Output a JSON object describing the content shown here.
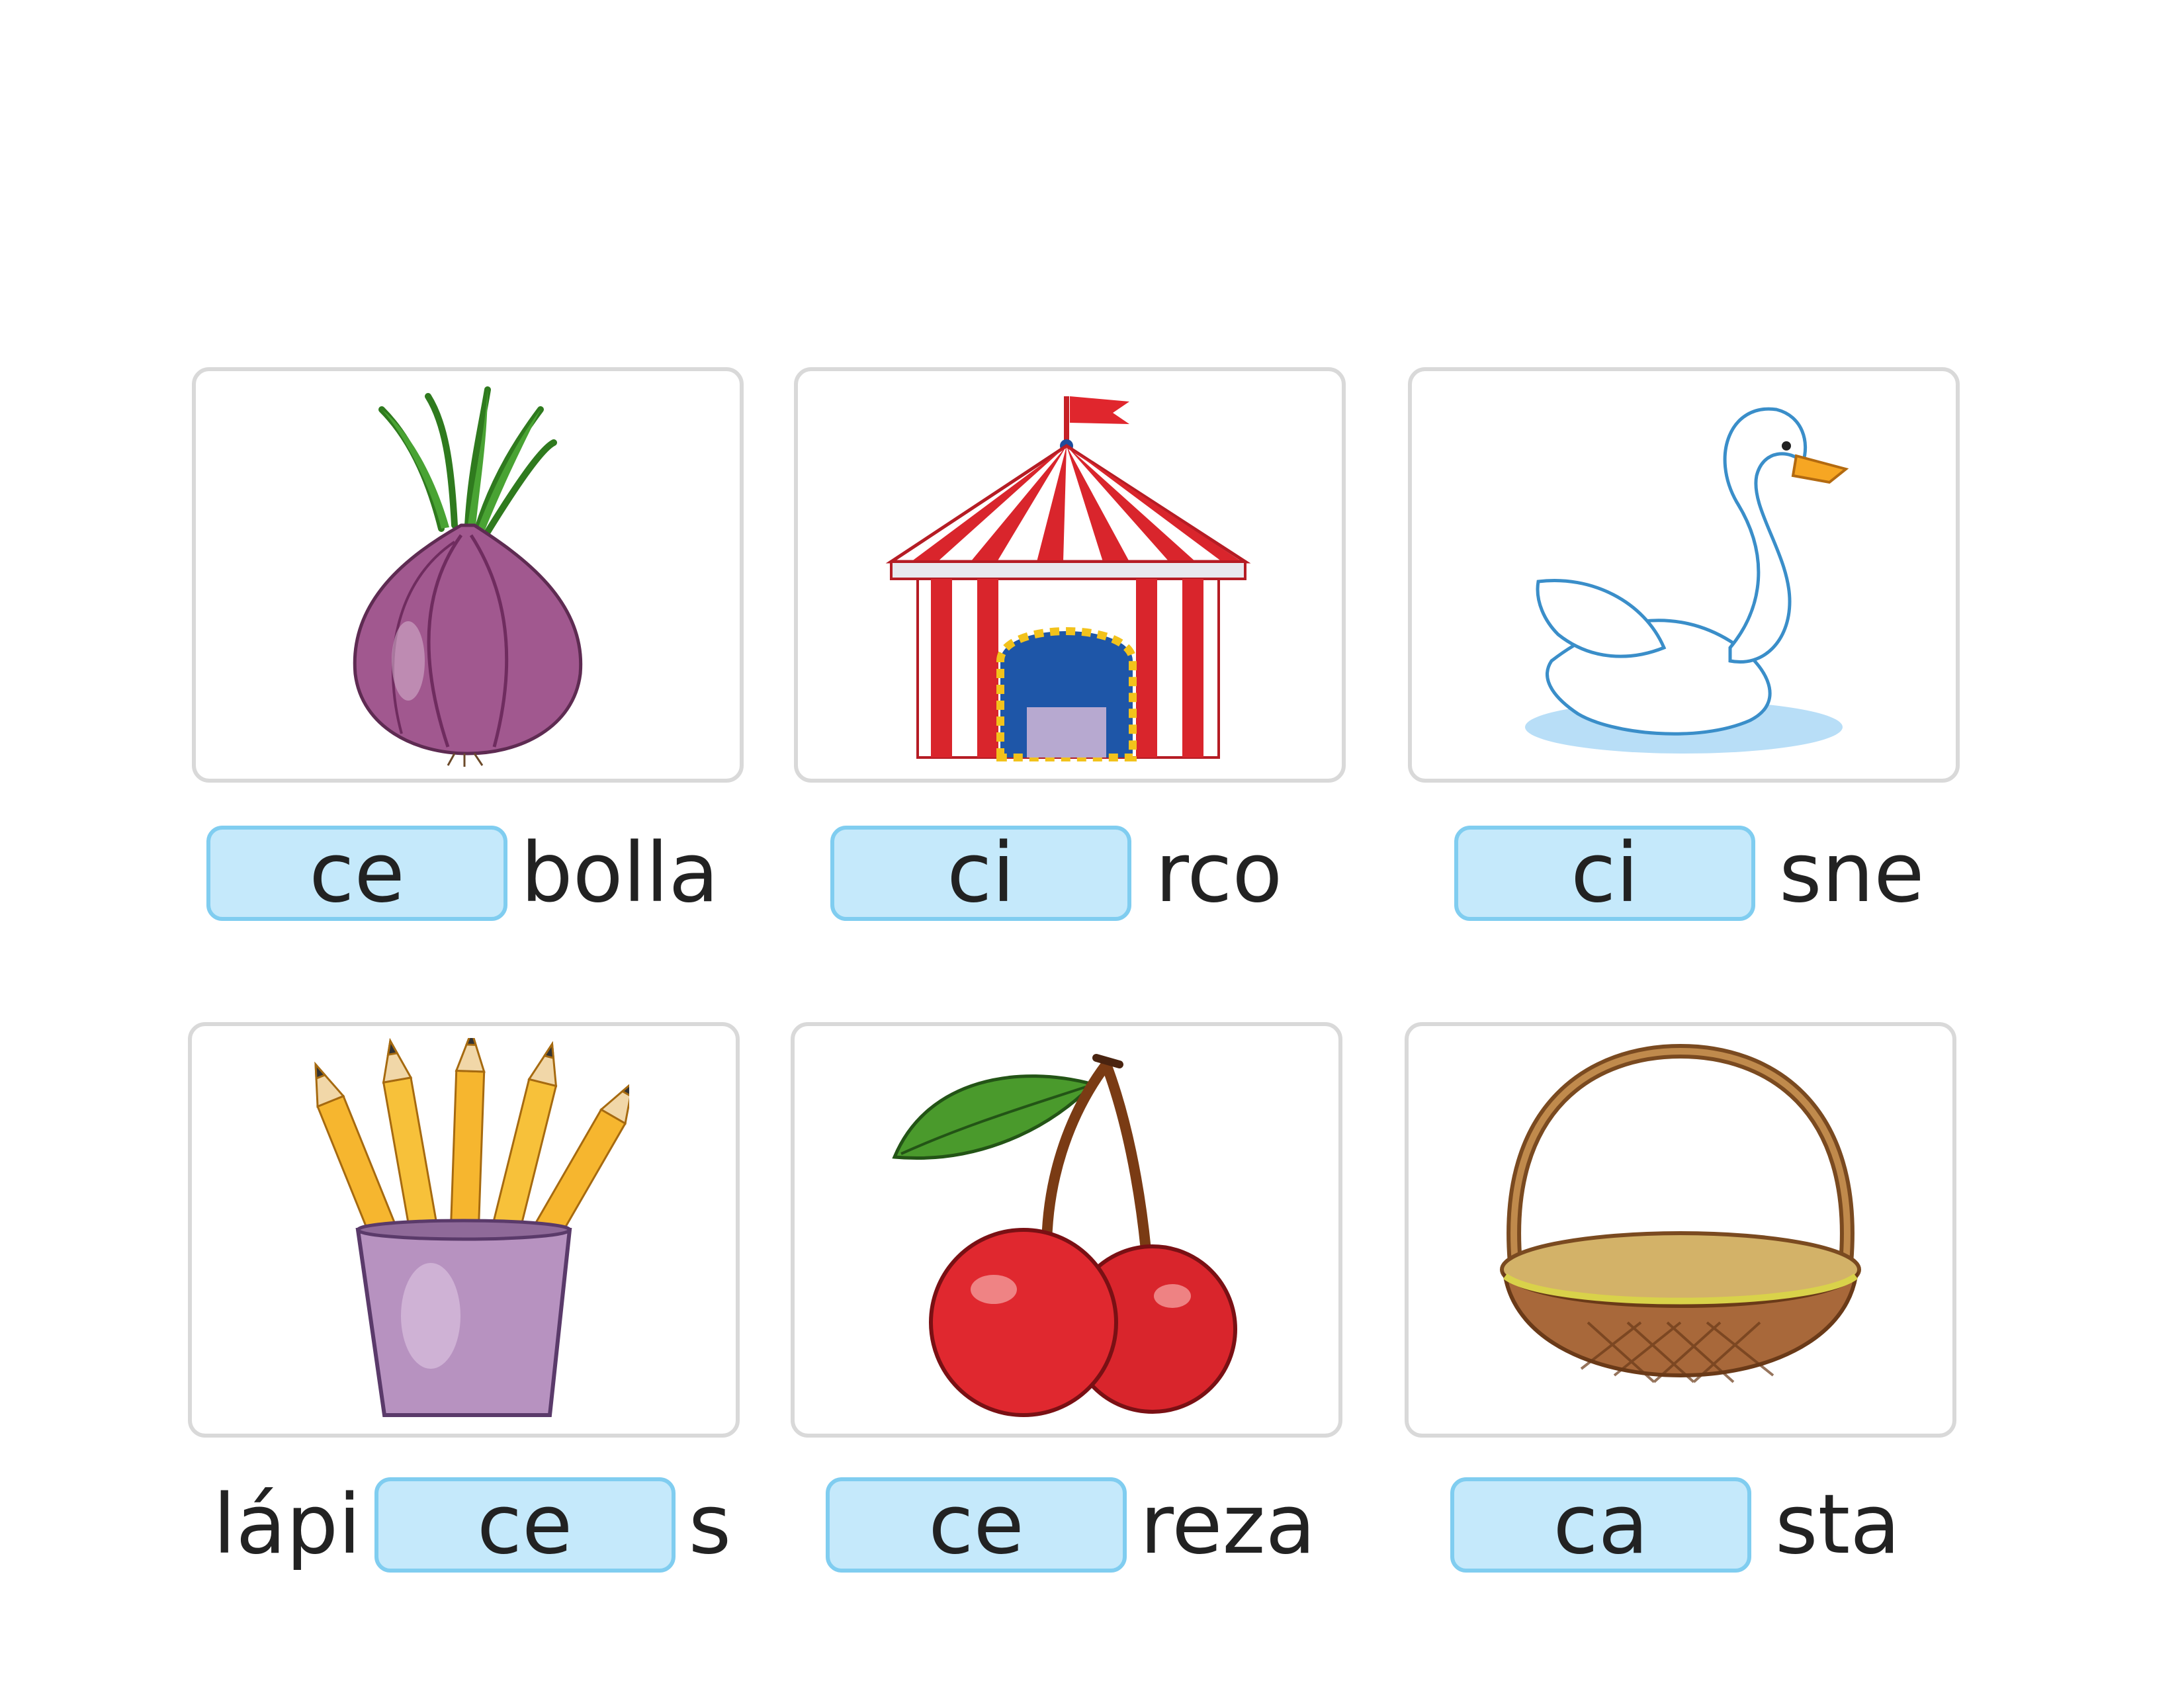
{
  "items": [
    {
      "picture": "onion-picture",
      "prefix": "",
      "answer": "ce",
      "suffix": "bolla"
    },
    {
      "picture": "circus-tent-picture",
      "prefix": "",
      "answer": "ci",
      "suffix": "rco"
    },
    {
      "picture": "swan-picture",
      "prefix": "",
      "answer": "ci",
      "suffix": "sne"
    },
    {
      "picture": "pencils-cup-picture",
      "prefix": "lápi",
      "answer": "ce",
      "suffix": "s"
    },
    {
      "picture": "cherries-picture",
      "prefix": "",
      "answer": "ce",
      "suffix": "reza"
    },
    {
      "picture": "basket-picture",
      "prefix": "",
      "answer": "ca",
      "suffix": "sta"
    }
  ],
  "colors": {
    "blank_fill": "#c5e9fb",
    "blank_border": "#80cdf0",
    "card_border": "#d9d9d9"
  }
}
